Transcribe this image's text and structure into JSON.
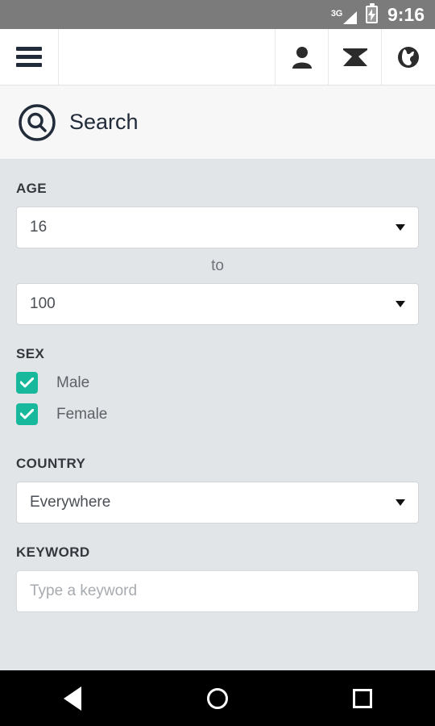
{
  "status_bar": {
    "network": "3G",
    "battery_icon": "battery-charging-icon",
    "signal_icon": "signal-bars-icon",
    "time": "9:16",
    "background_color": "#7b7b7b"
  },
  "toolbar": {
    "menu_icon": "hamburger-menu-icon",
    "icons": [
      {
        "name": "profile-icon",
        "label": "Profile"
      },
      {
        "name": "mail-icon",
        "label": "Messages"
      },
      {
        "name": "globe-icon",
        "label": "World"
      }
    ]
  },
  "search_header": {
    "icon": "search-circle-icon",
    "title": "Search"
  },
  "form": {
    "age": {
      "label": "AGE",
      "from_value": "16",
      "to_separator": "to",
      "to_value": "100",
      "caret_icon": "chevron-down-icon"
    },
    "sex": {
      "label": "SEX",
      "options": [
        {
          "label": "Male",
          "checked": true
        },
        {
          "label": "Female",
          "checked": true
        }
      ],
      "check_icon": "checkmark-icon",
      "accent_color": "#17b89b"
    },
    "country": {
      "label": "COUNTRY",
      "value": "Everywhere",
      "caret_icon": "chevron-down-icon"
    },
    "keyword": {
      "label": "KEYWORD",
      "value": "",
      "placeholder": "Type a keyword"
    }
  },
  "nav_bar": {
    "back": "back-triangle-icon",
    "home": "home-circle-icon",
    "recent": "recents-square-icon",
    "background_color": "#000000"
  }
}
